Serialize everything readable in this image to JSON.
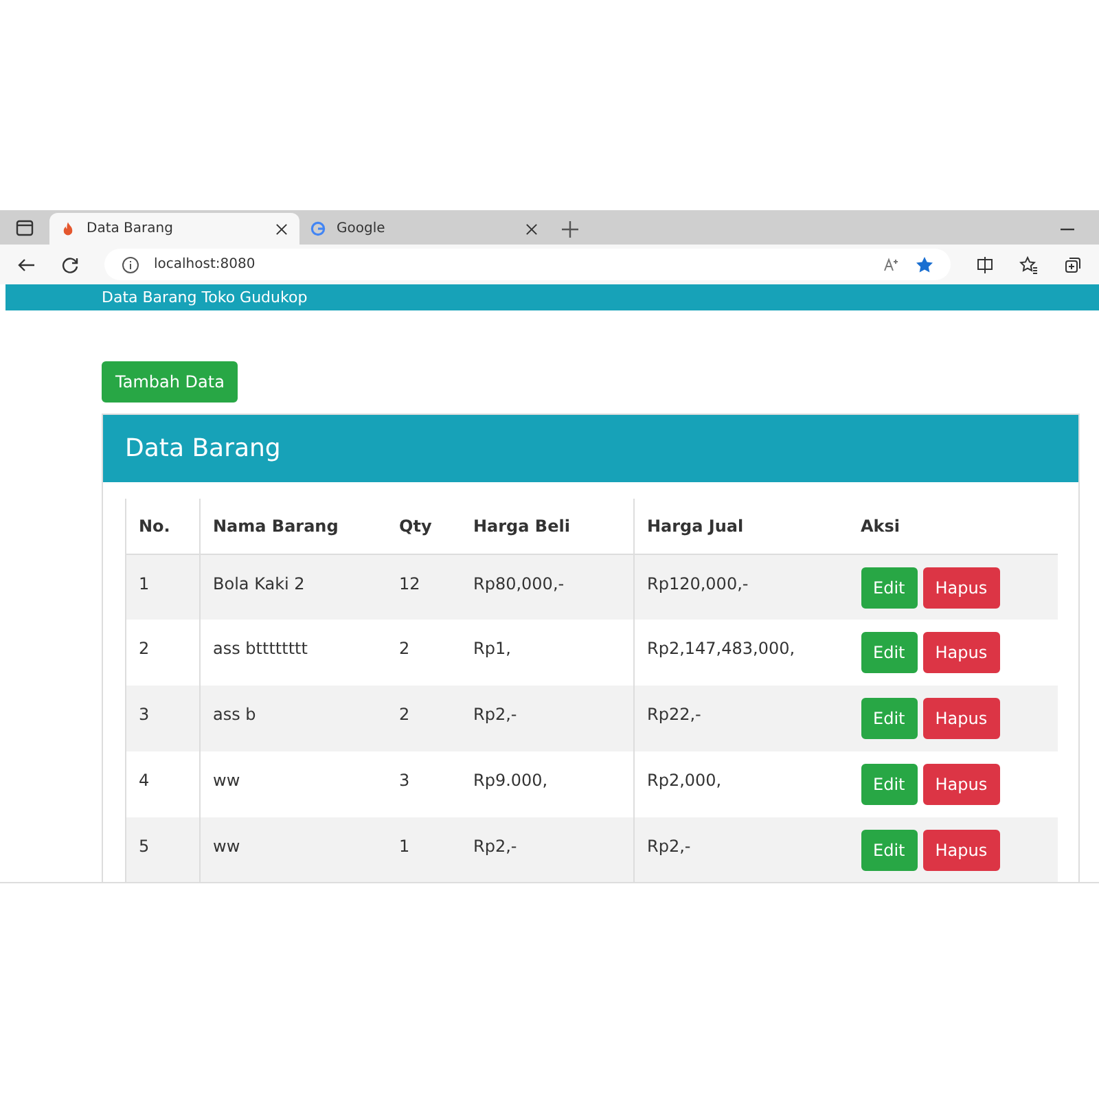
{
  "browser": {
    "tabs": [
      {
        "title": "Data Barang",
        "selected": true
      },
      {
        "title": "Google",
        "selected": false
      }
    ],
    "address": "localhost:8080"
  },
  "navbar": {
    "title": "Data Barang Toko Gudukop"
  },
  "add_button": "Tambah Data",
  "card": {
    "title": "Data Barang"
  },
  "table": {
    "columns": [
      "No.",
      "Nama Barang",
      "Qty",
      "Harga Beli",
      "Harga Jual",
      "Aksi"
    ],
    "rows": [
      {
        "cells": [
          "1",
          "Bola Kaki 2",
          "12",
          "Rp80,000,-",
          "Rp120,000,-"
        ],
        "actions": [
          "Edit",
          "Hapus"
        ]
      },
      {
        "cells": [
          "2",
          "ass btttttttt",
          "2",
          "Rp1,",
          "Rp2,147,483,000,"
        ],
        "actions": [
          "Edit",
          "Hapus"
        ]
      },
      {
        "cells": [
          "3",
          "ass b",
          "2",
          "Rp2,-",
          "Rp22,-"
        ],
        "actions": [
          "Edit",
          "Hapus"
        ]
      },
      {
        "cells": [
          "4",
          "ww",
          "3",
          "Rp9.000,",
          "Rp2,000,"
        ],
        "actions": [
          "Edit",
          "Hapus"
        ]
      },
      {
        "cells": [
          "5",
          "ww",
          "1",
          "Rp2,-",
          "Rp2,-"
        ],
        "actions": [
          "Edit",
          "Hapus"
        ]
      }
    ]
  }
}
